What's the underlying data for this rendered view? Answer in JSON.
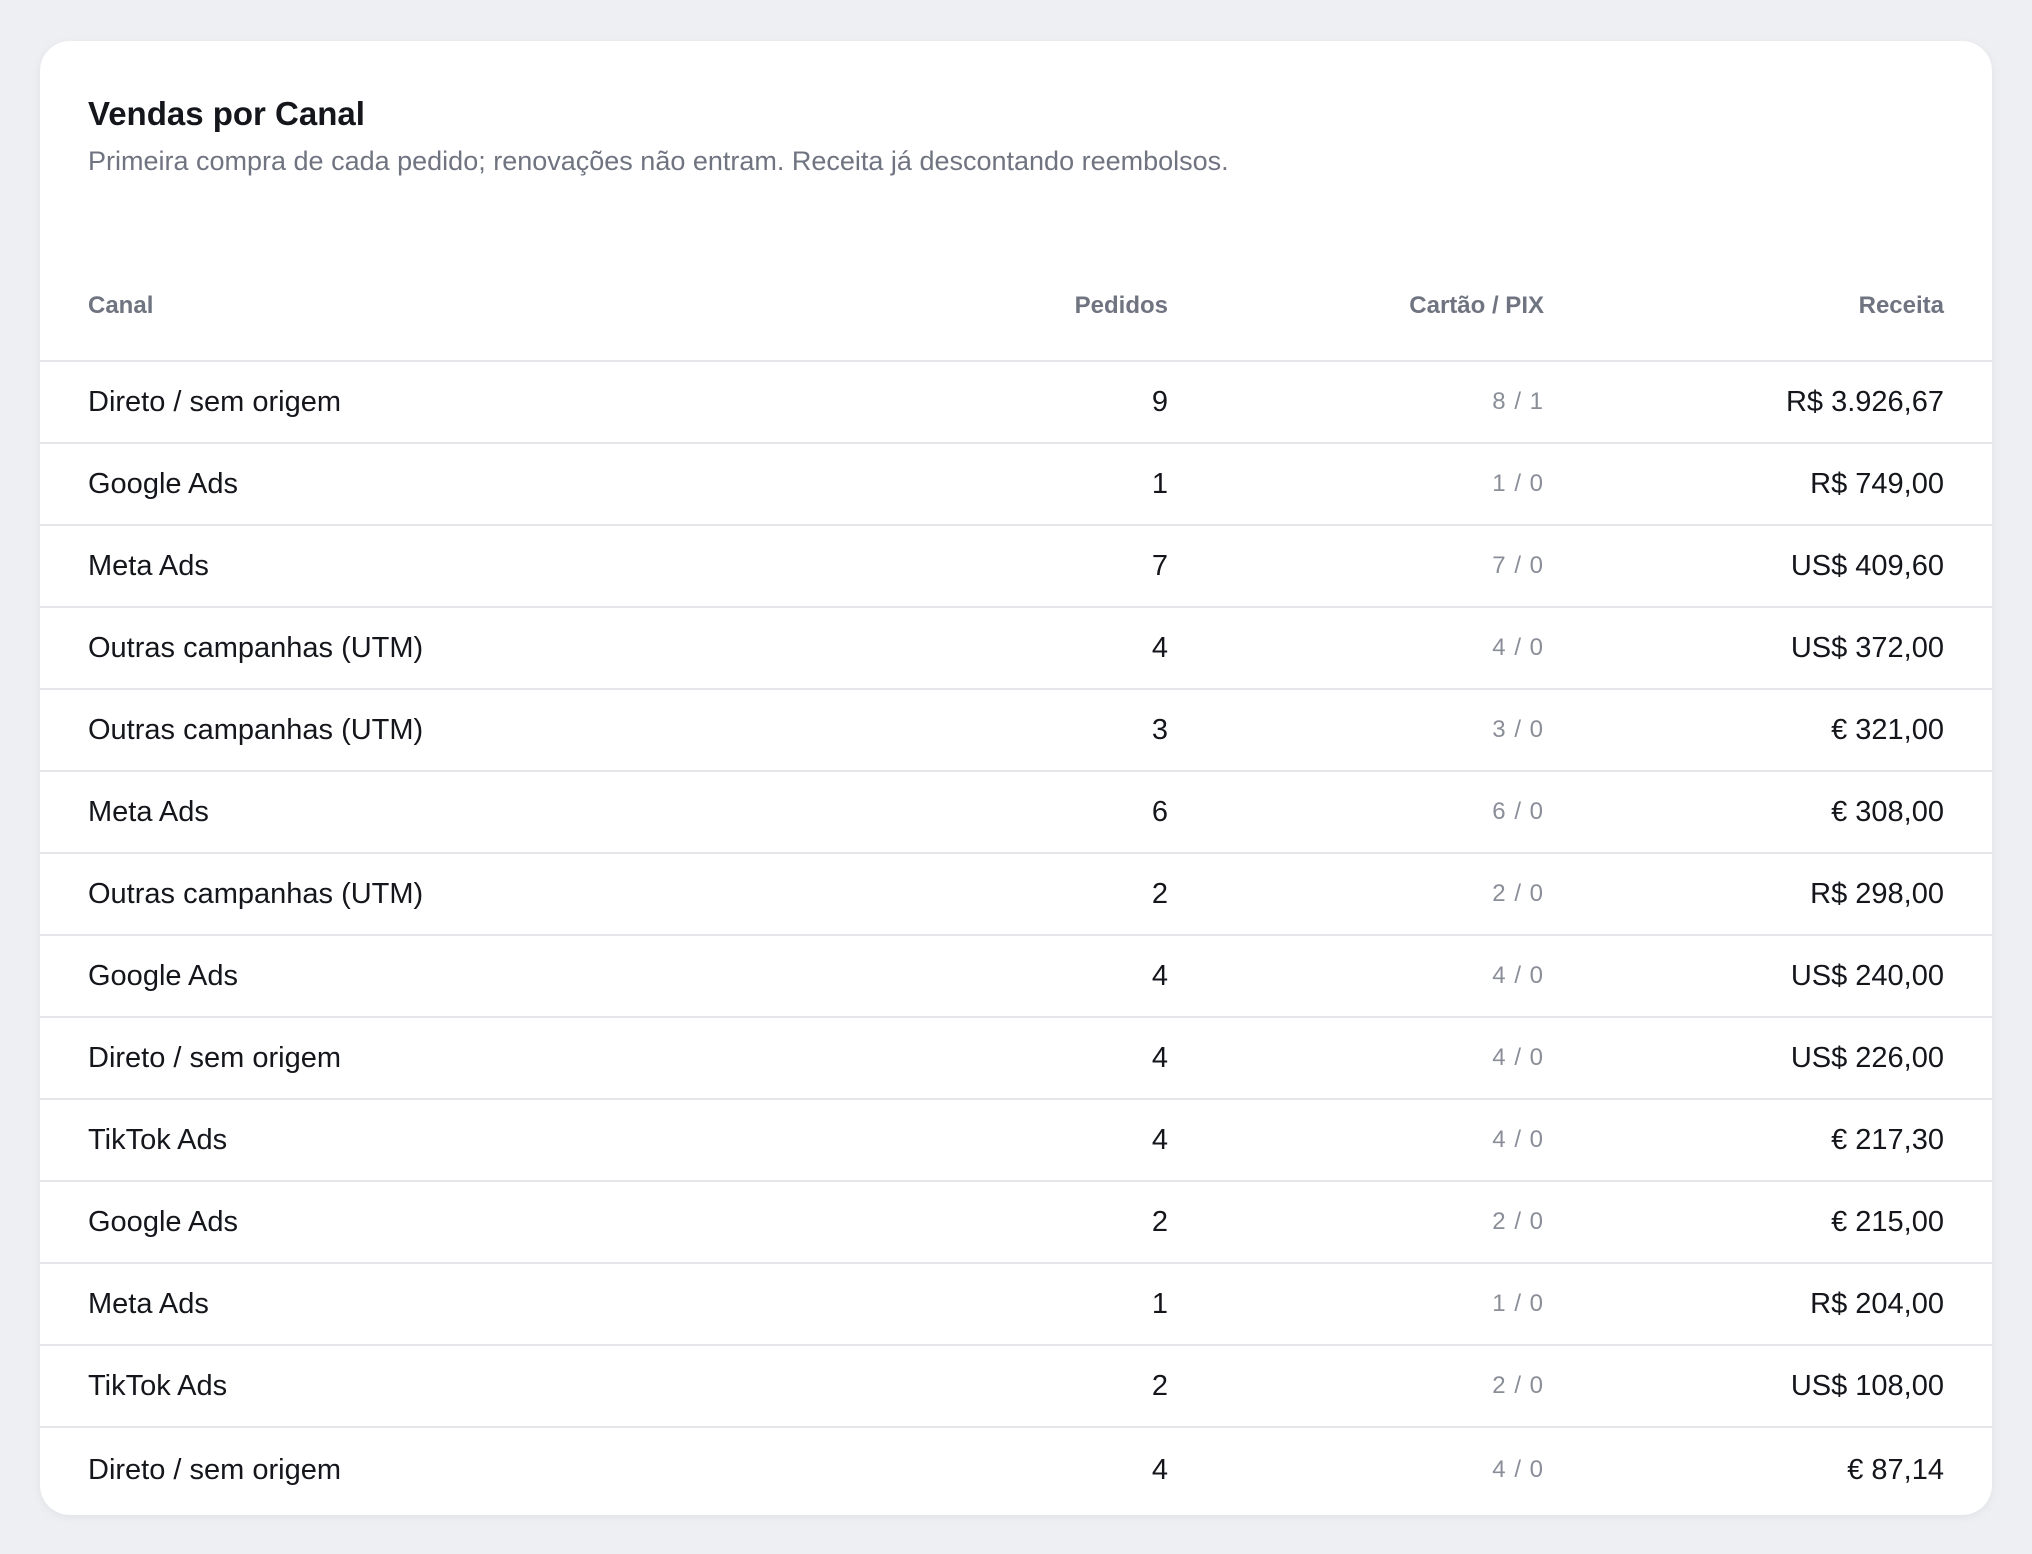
{
  "card": {
    "title": "Vendas por Canal",
    "subtitle": "Primeira compra de cada pedido; renovações não entram. Receita já descontando reembolsos."
  },
  "table": {
    "columns": {
      "canal": "Canal",
      "pedidos": "Pedidos",
      "pix": "Cartão / PIX",
      "receita": "Receita"
    },
    "rows": [
      {
        "canal": "Direto / sem origem",
        "pedidos": "9",
        "pix": "8 / 1",
        "receita": "R$ 3.926,67"
      },
      {
        "canal": "Google Ads",
        "pedidos": "1",
        "pix": "1 / 0",
        "receita": "R$ 749,00"
      },
      {
        "canal": "Meta Ads",
        "pedidos": "7",
        "pix": "7 / 0",
        "receita": "US$ 409,60"
      },
      {
        "canal": "Outras campanhas (UTM)",
        "pedidos": "4",
        "pix": "4 / 0",
        "receita": "US$ 372,00"
      },
      {
        "canal": "Outras campanhas (UTM)",
        "pedidos": "3",
        "pix": "3 / 0",
        "receita": "€ 321,00"
      },
      {
        "canal": "Meta Ads",
        "pedidos": "6",
        "pix": "6 / 0",
        "receita": "€ 308,00"
      },
      {
        "canal": "Outras campanhas (UTM)",
        "pedidos": "2",
        "pix": "2 / 0",
        "receita": "R$ 298,00"
      },
      {
        "canal": "Google Ads",
        "pedidos": "4",
        "pix": "4 / 0",
        "receita": "US$ 240,00"
      },
      {
        "canal": "Direto / sem origem",
        "pedidos": "4",
        "pix": "4 / 0",
        "receita": "US$ 226,00"
      },
      {
        "canal": "TikTok Ads",
        "pedidos": "4",
        "pix": "4 / 0",
        "receita": "€ 217,30"
      },
      {
        "canal": "Google Ads",
        "pedidos": "2",
        "pix": "2 / 0",
        "receita": "€ 215,00"
      },
      {
        "canal": "Meta Ads",
        "pedidos": "1",
        "pix": "1 / 0",
        "receita": "R$ 204,00"
      },
      {
        "canal": "TikTok Ads",
        "pedidos": "2",
        "pix": "2 / 0",
        "receita": "US$ 108,00"
      },
      {
        "canal": "Direto / sem origem",
        "pedidos": "4",
        "pix": "4 / 0",
        "receita": "€ 87,14"
      }
    ]
  }
}
